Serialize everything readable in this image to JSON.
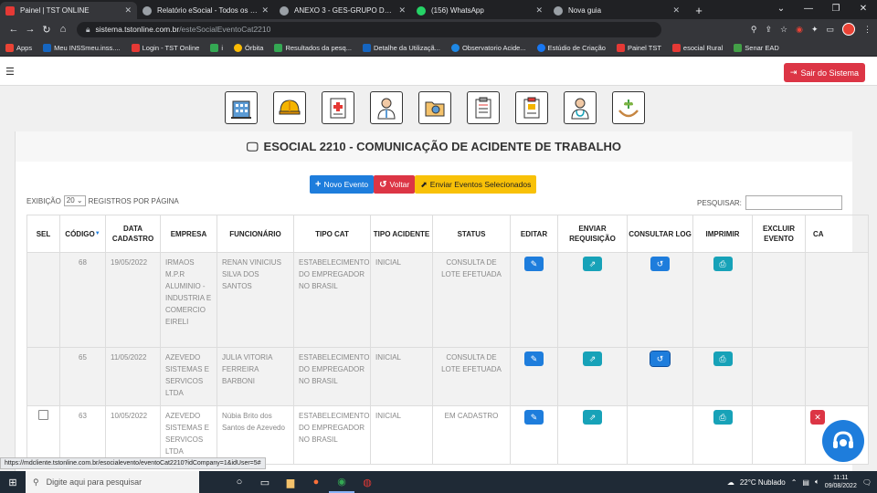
{
  "browser": {
    "tabs": [
      {
        "title": "Painel | TST ONLINE",
        "color": "#e53935",
        "active": true
      },
      {
        "title": "Relatório eSocial - Todos os Even",
        "color": "#9aa0a6",
        "active": false
      },
      {
        "title": "ANEXO 3 - GES-GRUPO DE EXPO",
        "color": "#9aa0a6",
        "active": false
      },
      {
        "title": "(156) WhatsApp",
        "color": "#25d366",
        "active": false
      },
      {
        "title": "Nova guia",
        "color": "#9aa0a6",
        "active": false
      }
    ],
    "url_domain": "sistema.tstonline.com.br",
    "url_path": "/esteSocialEventoCat2210",
    "bookmarks": [
      {
        "label": "Apps",
        "color": "#ea4335"
      },
      {
        "label": "Meu INSSmeu.inss....",
        "color": "#1565c0"
      },
      {
        "label": "Login - TST Online",
        "color": "#e53935"
      },
      {
        "label": "i",
        "color": "#34a853"
      },
      {
        "label": "Órbita",
        "color": "#fbbc05"
      },
      {
        "label": "Resultados da pesq...",
        "color": "#34a853"
      },
      {
        "label": "Detalhe da Utilizaçã...",
        "color": "#1565c0"
      },
      {
        "label": "Observatorio Acide...",
        "color": "#1e88e5"
      },
      {
        "label": "Estúdio de Criação",
        "color": "#1877f2"
      },
      {
        "label": "Painel TST",
        "color": "#e53935"
      },
      {
        "label": "esocial Rural",
        "color": "#e53935"
      },
      {
        "label": "Senar EAD",
        "color": "#43a047"
      }
    ]
  },
  "header": {
    "logout_label": "Sair do Sistema",
    "modules": [
      "building-icon",
      "helmet-icon",
      "medical-record-icon",
      "doctor-icon",
      "folder-icon",
      "clipboard-icon",
      "checklist-icon",
      "physician-icon",
      "care-hands-icon"
    ]
  },
  "card": {
    "title": "ESOCIAL 2210 - COMUNICAÇÃO DE ACIDENTE DE TRABALHO",
    "buttons": {
      "new": "Novo Evento",
      "back": "Voltar",
      "send": "Enviar Eventos Selecionados"
    },
    "exib_prefix": "EXIBIÇÃO",
    "exib_value": "20",
    "exib_suffix": "REGISTROS POR PÁGINA",
    "search_label": "PESQUISAR:"
  },
  "table": {
    "headers": [
      "SEL",
      "CÓDIGO",
      "DATA CADASTRO",
      "EMPRESA",
      "FUNCIONÁRIO",
      "TIPO CAT",
      "TIPO ACIDENTE",
      "STATUS",
      "EDITAR",
      "ENVIAR REQUISIÇÃO",
      "CONSULTAR LOG",
      "IMPRIMIR",
      "EXCLUIR EVENTO",
      "CA"
    ],
    "rows": [
      {
        "codigo": "68",
        "data": "19/05/2022",
        "empresa": "IRMAOS M.P.R ALUMINIO - INDUSTRIA E COMERCIO EIRELI",
        "funcionario": "RENAN VINICIUS SILVA DOS SANTOS",
        "tipo_cat": "ESTABELECIMENTO DO EMPREGADOR NO BRASIL",
        "tipo_acidente": "INICIAL",
        "status": "CONSULTA DE LOTE EFETUADA"
      },
      {
        "codigo": "65",
        "data": "11/05/2022",
        "empresa": "AZEVEDO SISTEMAS E SERVICOS LTDA",
        "funcionario": "JULIA VITORIA FERREIRA BARBONI",
        "tipo_cat": "ESTABELECIMENTO DO EMPREGADOR NO BRASIL",
        "tipo_acidente": "INICIAL",
        "status": "CONSULTA DE LOTE EFETUADA"
      },
      {
        "codigo": "63",
        "data": "10/05/2022",
        "empresa": "AZEVEDO SISTEMAS E SERVICOS LTDA",
        "funcionario": "Núbia Brito dos Santos de Azevedo",
        "tipo_cat": "ESTABELECIMENTO DO EMPREGADOR NO BRASIL",
        "tipo_acidente": "INICIAL",
        "status": "EM CADASTRO"
      }
    ]
  },
  "status_url": "https://mdcliente.tstonline.com.br/esocialevento/eventoCat2210?idCompany=1&idUser=5#",
  "taskbar": {
    "search_placeholder": "Digite aqui para pesquisar",
    "weather": "22°C  Nublado",
    "time": "11:11",
    "date": "09/08/2022"
  }
}
